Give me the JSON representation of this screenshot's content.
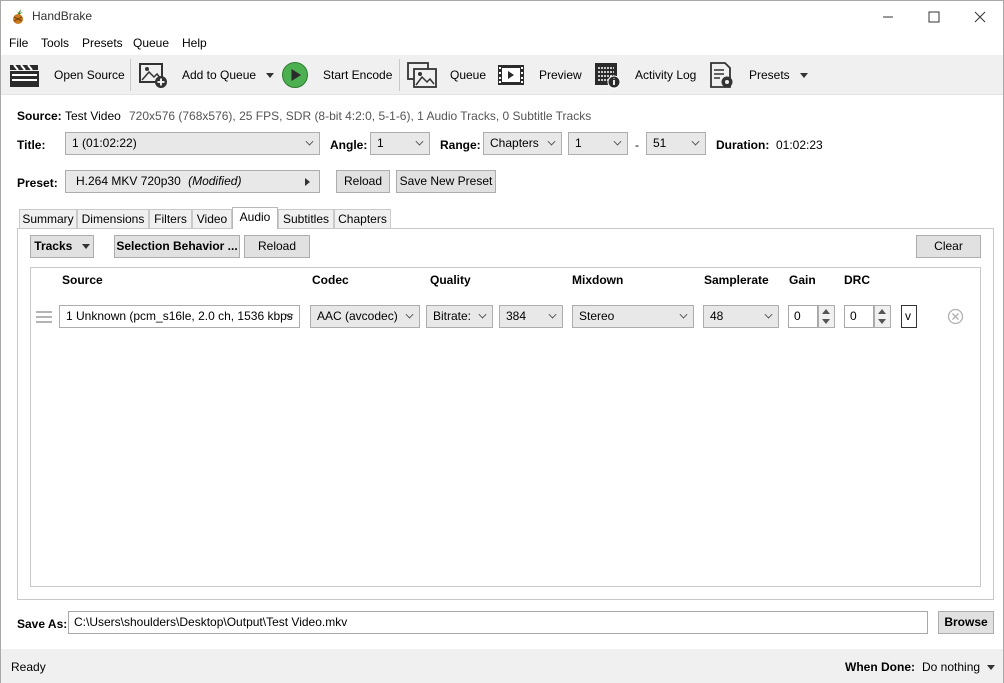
{
  "window": {
    "title": "HandBrake"
  },
  "menu": [
    "File",
    "Tools",
    "Presets",
    "Queue",
    "Help"
  ],
  "toolbar": {
    "open_source": "Open Source",
    "add_to_queue": "Add to Queue",
    "start_encode": "Start Encode",
    "queue": "Queue",
    "preview": "Preview",
    "activity_log": "Activity Log",
    "presets": "Presets"
  },
  "source": {
    "label": "Source:",
    "name": "Test Video",
    "info": "720x576 (768x576), 25 FPS, SDR (8-bit 4:2:0, 5-1-6), 1 Audio Tracks, 0 Subtitle Tracks"
  },
  "title_row": {
    "title_label": "Title:",
    "title_value": "1  (01:02:22)",
    "angle_label": "Angle:",
    "angle_value": "1",
    "range_label": "Range:",
    "range_type": "Chapters",
    "range_start": "1",
    "range_dash": "-",
    "range_end": "51",
    "duration_label": "Duration:",
    "duration_value": "01:02:23"
  },
  "preset_row": {
    "label": "Preset:",
    "name": "H.264 MKV 720p30",
    "modified": "(Modified)",
    "reload": "Reload",
    "save_new": "Save New Preset"
  },
  "tabs": [
    "Summary",
    "Dimensions",
    "Filters",
    "Video",
    "Audio",
    "Subtitles",
    "Chapters"
  ],
  "active_tab": "Audio",
  "audio": {
    "tracks_btn": "Tracks",
    "selection_behavior_btn": "Selection Behavior ...",
    "reload_btn": "Reload",
    "clear_btn": "Clear",
    "columns": {
      "source": "Source",
      "codec": "Codec",
      "quality": "Quality",
      "mixdown": "Mixdown",
      "samplerate": "Samplerate",
      "gain": "Gain",
      "drc": "DRC"
    },
    "track": {
      "source": "1 Unknown (pcm_s16le, 2.0 ch, 1536 kbps",
      "codec": "AAC (avcodec)",
      "quality_mode": "Bitrate:",
      "bitrate": "384",
      "mixdown": "Stereo",
      "samplerate": "48",
      "gain": "0",
      "drc": "0",
      "extra": "v"
    }
  },
  "save_as": {
    "label": "Save As:",
    "path": "C:\\Users\\shoulders\\Desktop\\Output\\Test Video.mkv",
    "browse": "Browse"
  },
  "status": {
    "text": "Ready",
    "when_done_label": "When Done:",
    "when_done_value": "Do nothing"
  },
  "colors": {
    "start_encode_green": "#4caf50",
    "panel_bg": "#f0f0f0"
  }
}
